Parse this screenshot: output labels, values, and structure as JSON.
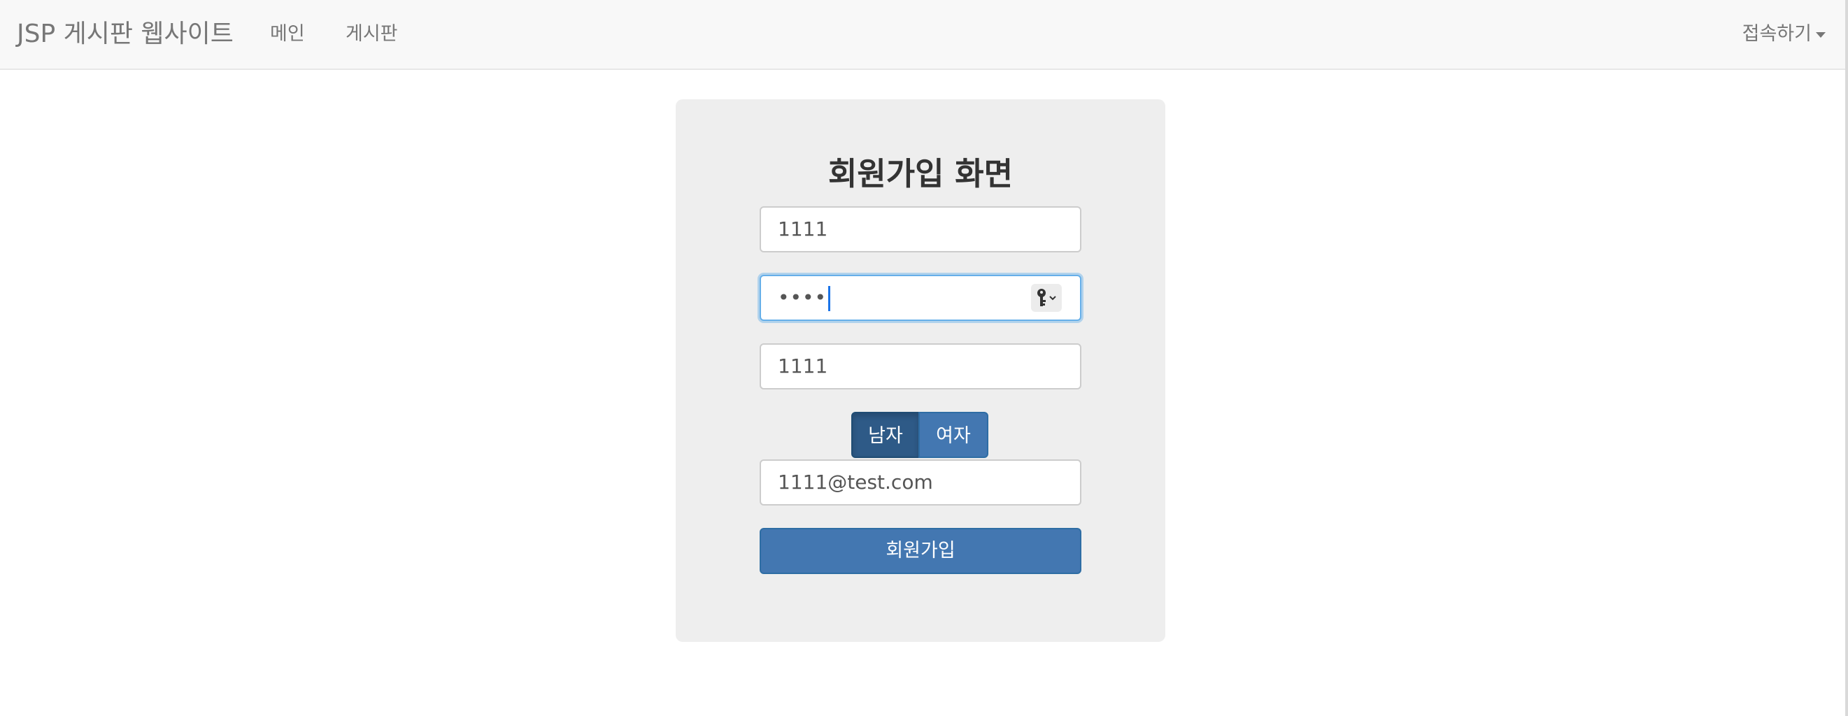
{
  "navbar": {
    "brand": "JSP 게시판 웹사이트",
    "links": [
      {
        "label": "메인"
      },
      {
        "label": "게시판"
      }
    ],
    "dropdown_label": "접속하기"
  },
  "form": {
    "title": "회원가입 화면",
    "user_id_value": "1111",
    "password_masked": "••••",
    "user_name_value": "1111",
    "gender_options": [
      "남자",
      "여자"
    ],
    "gender_selected": "남자",
    "email_value": "1111@test.com",
    "submit_label": "회원가입"
  },
  "colors": {
    "navbar_bg": "#f8f8f8",
    "panel_bg": "#eeeeee",
    "primary": "#4377b1",
    "primary_active": "#2e5a87",
    "focus": "#66afe9"
  },
  "icons": {
    "password_manager": "key-icon",
    "dropdown": "caret-down-icon"
  }
}
